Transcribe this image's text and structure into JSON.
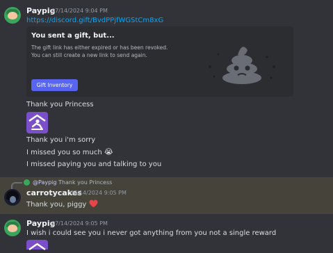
{
  "messages": {
    "m1": {
      "username": "Paypig",
      "timestamp": "07/14/2024 9:04 PM",
      "link": "https://discord.gift/BvdPPjfWGStCm8xG",
      "gift_card": {
        "title": "You sent a gift, but...",
        "body": "The gift link has either expired or has been revoked. You can still create a new link to send again.",
        "button_label": "Gift Inventory"
      },
      "lines": {
        "l1": "Thank you Princess",
        "l2": "Thank you i'm sorry",
        "l3": "I missed you so much",
        "l4": "I missed paying you and talking to you"
      },
      "reaction_emoji": "😭"
    },
    "m2": {
      "reply_mention": "@Paypig",
      "reply_text": "Thank you Princess",
      "username": "carrotycakes",
      "timestamp": "07/14/2024 9:05 PM",
      "text": "Thank you, piggy",
      "emoji": "❤️"
    },
    "m3": {
      "username": "Paypig",
      "timestamp": "07/14/2024 9:05 PM",
      "text": "I wish i could see you i never got anything from you not a single reward"
    }
  },
  "colors": {
    "background": "#313338",
    "highlight": "#45433a",
    "link": "#00a8fc",
    "button": "#5865f2",
    "heart": "#e8454b",
    "emoji_purple": "#7b4fc9"
  },
  "icons": {
    "gift_art": "poop-icon",
    "kneel_emoji": "kneeling-person-icon",
    "heart": "heart-icon"
  }
}
